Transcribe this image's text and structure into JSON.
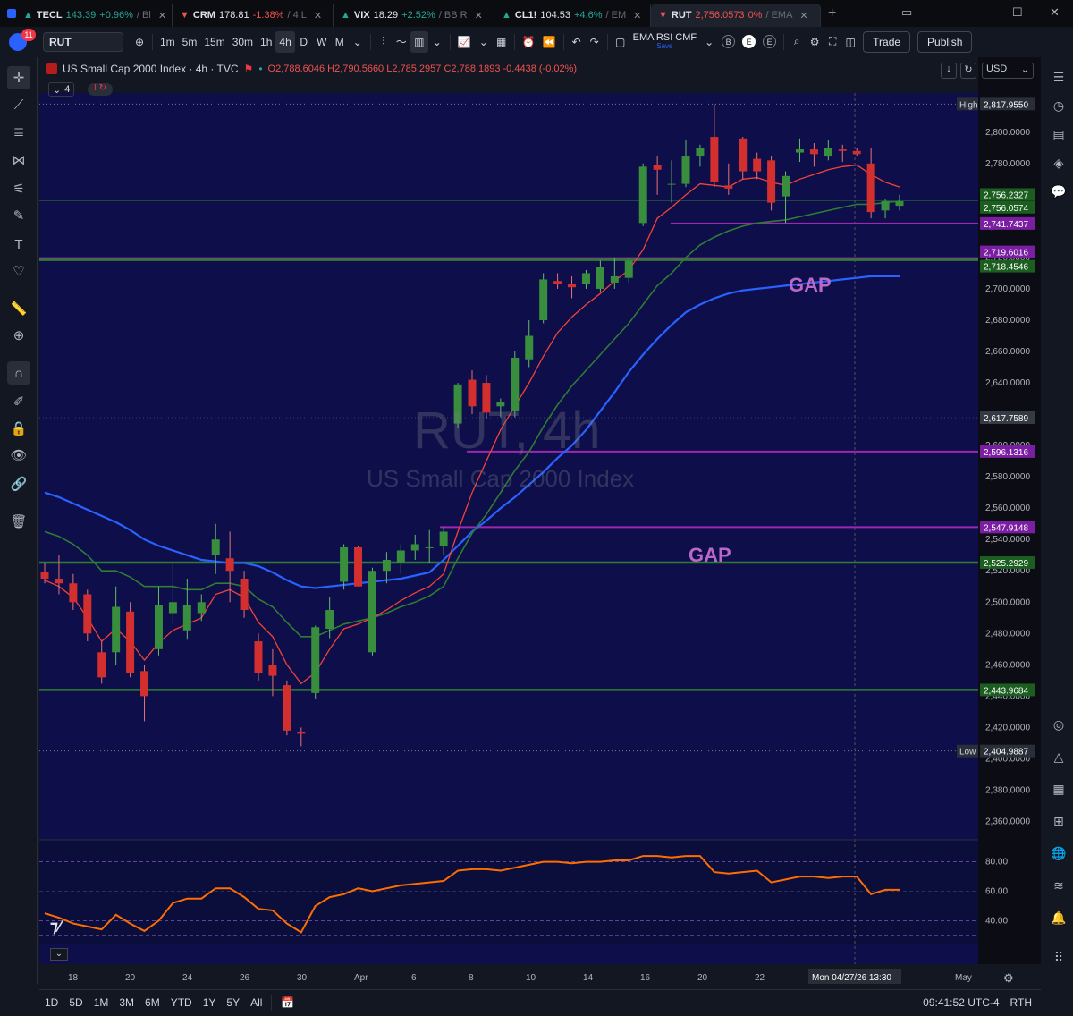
{
  "browser_tabs": [
    {
      "symbol": "TECL",
      "direction": "up",
      "price": "143.39",
      "change": "+0.96%",
      "extra": "/ Bl"
    },
    {
      "symbol": "CRM",
      "direction": "down",
      "price": "178.81",
      "change": "-1.38%",
      "extra": "/ 4 L"
    },
    {
      "symbol": "VIX",
      "direction": "up",
      "price": "18.29",
      "change": "+2.52%",
      "extra": "/ BB R"
    },
    {
      "symbol": "CL1!",
      "direction": "up",
      "price": "104.53",
      "change": "+4.6%",
      "extra": "/ EM"
    },
    {
      "symbol": "RUT",
      "direction": "down",
      "price": "2,756.0573",
      "change": "0%",
      "extra": "/ EMA",
      "active": true
    }
  ],
  "toolbar": {
    "symbol": "RUT",
    "notification_count": "11",
    "intervals": [
      "1m",
      "5m",
      "15m",
      "30m",
      "1h",
      "4h",
      "D",
      "W",
      "M"
    ],
    "selected_interval": "4h",
    "indicator_template": "EMA RSI CMF",
    "template_state": "Save",
    "markers": [
      "B",
      "E",
      "E"
    ],
    "trade_label": "Trade",
    "publish_label": "Publish"
  },
  "legend": {
    "title": "US Small Cap 2000 Index · 4h · TVC",
    "ohlc": "O2,788.6046 H2,790.5660 L2,785.2957 C2,788.1893 -0.4438 (-0.02%)",
    "indicator_count": "4",
    "currency": "USD"
  },
  "watermark": {
    "symbol": "RUT, 4h",
    "name": "US Small Cap 2000 Index"
  },
  "gap_labels": [
    "GAP",
    "GAP"
  ],
  "price_axis": {
    "ticks": [
      "2,800.0000",
      "2,780.0000",
      "2,760.0000",
      "2,740.0000",
      "2,720.0000",
      "2,700.0000",
      "2,680.0000",
      "2,660.0000",
      "2,640.0000",
      "2,620.0000",
      "2,600.0000",
      "2,580.0000",
      "2,560.0000",
      "2,540.0000",
      "2,520.0000",
      "2,500.0000",
      "2,480.0000",
      "2,460.0000",
      "2,440.0000",
      "2,420.0000",
      "2,400.0000",
      "2,380.0000",
      "2,360.0000"
    ],
    "tags": [
      {
        "label": "High",
        "value": "2,817.9550",
        "kind": "extreme"
      },
      {
        "value": "2,756.2327",
        "kind": "green"
      },
      {
        "value": "2,756.0574",
        "kind": "green"
      },
      {
        "value": "2,741.7437",
        "kind": "purple"
      },
      {
        "value": "2,719.6016",
        "kind": "purple"
      },
      {
        "value": "2,718.4546",
        "kind": "green"
      },
      {
        "value": "2,617.7589",
        "kind": "dark"
      },
      {
        "value": "2,596.1316",
        "kind": "purple"
      },
      {
        "value": "2,547.9148",
        "kind": "purple"
      },
      {
        "value": "2,525.2929",
        "kind": "green"
      },
      {
        "value": "2,443.9684",
        "kind": "green"
      },
      {
        "label": "Low",
        "value": "2,404.9887",
        "kind": "extreme"
      }
    ]
  },
  "rsi_axis": [
    "80.00",
    "60.00",
    "40.00"
  ],
  "time_axis": [
    "18",
    "20",
    "24",
    "26",
    "30",
    "Apr",
    "6",
    "8",
    "10",
    "14",
    "16",
    "20",
    "22",
    "May"
  ],
  "crosshair_time": "Mon 04/27/26   13:30",
  "bottom_bar": {
    "ranges": [
      "1D",
      "5D",
      "1M",
      "3M",
      "6M",
      "YTD",
      "1Y",
      "5Y",
      "All"
    ],
    "clock": "09:41:52 UTC-4",
    "session": "RTH"
  },
  "colors": {
    "background": "#131722",
    "up_candle": "#388e3c",
    "down_candle": "#d32f2f",
    "ema_fast": "#f44336",
    "ema_mid": "#2e7d32",
    "ema_slow": "#2962ff",
    "level_purple": "#9c27b0",
    "level_green": "#2e7d32",
    "rsi_line": "#ff6d00"
  },
  "chart_data": {
    "type": "candlestick",
    "interval": "4h",
    "candles": [
      {
        "o": 2519,
        "h": 2525,
        "l": 2512,
        "c": 2515
      },
      {
        "o": 2515,
        "h": 2530,
        "l": 2505,
        "c": 2512
      },
      {
        "o": 2512,
        "h": 2518,
        "l": 2495,
        "c": 2500
      },
      {
        "o": 2505,
        "h": 2508,
        "l": 2475,
        "c": 2480
      },
      {
        "o": 2468,
        "h": 2475,
        "l": 2448,
        "c": 2452
      },
      {
        "o": 2468,
        "h": 2510,
        "l": 2460,
        "c": 2497
      },
      {
        "o": 2494,
        "h": 2500,
        "l": 2452,
        "c": 2455
      },
      {
        "o": 2456,
        "h": 2460,
        "l": 2424,
        "c": 2440
      },
      {
        "o": 2470,
        "h": 2510,
        "l": 2466,
        "c": 2498
      },
      {
        "o": 2493,
        "h": 2525,
        "l": 2486,
        "c": 2500
      },
      {
        "o": 2482,
        "h": 2515,
        "l": 2476,
        "c": 2498
      },
      {
        "o": 2493,
        "h": 2505,
        "l": 2488,
        "c": 2500
      },
      {
        "o": 2530,
        "h": 2550,
        "l": 2518,
        "c": 2540
      },
      {
        "o": 2528,
        "h": 2545,
        "l": 2500,
        "c": 2520
      },
      {
        "o": 2515,
        "h": 2520,
        "l": 2490,
        "c": 2495
      },
      {
        "o": 2475,
        "h": 2480,
        "l": 2450,
        "c": 2455
      },
      {
        "o": 2460,
        "h": 2470,
        "l": 2440,
        "c": 2453
      },
      {
        "o": 2447,
        "h": 2450,
        "l": 2415,
        "c": 2418
      },
      {
        "o": 2417,
        "h": 2420,
        "l": 2408,
        "c": 2416
      },
      {
        "o": 2442,
        "h": 2485,
        "l": 2438,
        "c": 2484
      },
      {
        "o": 2483,
        "h": 2503,
        "l": 2477,
        "c": 2495
      },
      {
        "o": 2513,
        "h": 2537,
        "l": 2508,
        "c": 2535
      },
      {
        "o": 2535,
        "h": 2536,
        "l": 2510,
        "c": 2510
      },
      {
        "o": 2468,
        "h": 2522,
        "l": 2466,
        "c": 2520
      },
      {
        "o": 2520,
        "h": 2532,
        "l": 2512,
        "c": 2527
      },
      {
        "o": 2525,
        "h": 2537,
        "l": 2518,
        "c": 2533
      },
      {
        "o": 2533,
        "h": 2543,
        "l": 2527,
        "c": 2537
      },
      {
        "o": 2535,
        "h": 2546,
        "l": 2525,
        "c": 2535
      },
      {
        "o": 2536,
        "h": 2548,
        "l": 2530,
        "c": 2545
      },
      {
        "o": 2614,
        "h": 2640,
        "l": 2611,
        "c": 2639
      },
      {
        "o": 2642,
        "h": 2648,
        "l": 2620,
        "c": 2625
      },
      {
        "o": 2640,
        "h": 2645,
        "l": 2617,
        "c": 2621
      },
      {
        "o": 2625,
        "h": 2630,
        "l": 2618,
        "c": 2628
      },
      {
        "o": 2622,
        "h": 2660,
        "l": 2618,
        "c": 2656
      },
      {
        "o": 2655,
        "h": 2680,
        "l": 2650,
        "c": 2670
      },
      {
        "o": 2680,
        "h": 2710,
        "l": 2678,
        "c": 2706
      },
      {
        "o": 2705,
        "h": 2710,
        "l": 2700,
        "c": 2703
      },
      {
        "o": 2703,
        "h": 2708,
        "l": 2694,
        "c": 2701
      },
      {
        "o": 2703,
        "h": 2712,
        "l": 2700,
        "c": 2710
      },
      {
        "o": 2700,
        "h": 2718,
        "l": 2698,
        "c": 2714
      },
      {
        "o": 2704,
        "h": 2720,
        "l": 2700,
        "c": 2708
      },
      {
        "o": 2707,
        "h": 2720,
        "l": 2704,
        "c": 2718
      },
      {
        "o": 2742,
        "h": 2780,
        "l": 2740,
        "c": 2778
      },
      {
        "o": 2779,
        "h": 2785,
        "l": 2760,
        "c": 2776
      },
      {
        "o": 2767,
        "h": 2782,
        "l": 2755,
        "c": 2767
      },
      {
        "o": 2767,
        "h": 2795,
        "l": 2765,
        "c": 2785
      },
      {
        "o": 2785,
        "h": 2792,
        "l": 2778,
        "c": 2790
      },
      {
        "o": 2797,
        "h": 2818,
        "l": 2765,
        "c": 2768
      },
      {
        "o": 2766,
        "h": 2780,
        "l": 2760,
        "c": 2764
      },
      {
        "o": 2796,
        "h": 2797,
        "l": 2770,
        "c": 2775
      },
      {
        "o": 2783,
        "h": 2787,
        "l": 2770,
        "c": 2775
      },
      {
        "o": 2782,
        "h": 2785,
        "l": 2750,
        "c": 2755
      },
      {
        "o": 2759,
        "h": 2775,
        "l": 2742,
        "c": 2772
      },
      {
        "o": 2787,
        "h": 2796,
        "l": 2781,
        "c": 2789
      },
      {
        "o": 2789,
        "h": 2793,
        "l": 2778,
        "c": 2786
      },
      {
        "o": 2785,
        "h": 2795,
        "l": 2782,
        "c": 2790
      },
      {
        "o": 2789,
        "h": 2792,
        "l": 2781,
        "c": 2788
      },
      {
        "o": 2788,
        "h": 2790,
        "l": 2785,
        "c": 2786
      },
      {
        "o": 2780,
        "h": 2790,
        "l": 2745,
        "c": 2749
      },
      {
        "o": 2750,
        "h": 2757,
        "l": 2745,
        "c": 2756
      },
      {
        "o": 2753,
        "h": 2760,
        "l": 2750,
        "c": 2756
      }
    ],
    "ema_fast": [
      2514,
      2510,
      2503,
      2490,
      2475,
      2483,
      2475,
      2463,
      2474,
      2482,
      2486,
      2490,
      2505,
      2508,
      2503,
      2487,
      2478,
      2460,
      2448,
      2455,
      2470,
      2483,
      2486,
      2490,
      2495,
      2501,
      2506,
      2510,
      2518,
      2545,
      2570,
      2590,
      2610,
      2625,
      2640,
      2657,
      2672,
      2682,
      2690,
      2697,
      2705,
      2712,
      2725,
      2745,
      2752,
      2760,
      2767,
      2766,
      2765,
      2770,
      2771,
      2768,
      2766,
      2770,
      2773,
      2776,
      2778,
      2779,
      2773,
      2768,
      2765
    ],
    "ema_mid": [
      2545,
      2542,
      2537,
      2530,
      2520,
      2520,
      2516,
      2510,
      2510,
      2510,
      2508,
      2508,
      2512,
      2512,
      2510,
      2502,
      2497,
      2487,
      2478,
      2478,
      2482,
      2486,
      2488,
      2490,
      2493,
      2497,
      2500,
      2504,
      2510,
      2528,
      2544,
      2556,
      2570,
      2584,
      2596,
      2612,
      2626,
      2638,
      2648,
      2658,
      2668,
      2678,
      2690,
      2702,
      2710,
      2720,
      2728,
      2733,
      2737,
      2740,
      2742,
      2743,
      2744,
      2746,
      2748,
      2750,
      2752,
      2754,
      2754,
      2755,
      2756
    ],
    "ema_slow": [
      2570,
      2567,
      2563,
      2559,
      2555,
      2551,
      2546,
      2540,
      2536,
      2533,
      2530,
      2527,
      2526,
      2525,
      2525,
      2523,
      2519,
      2514,
      2510,
      2509,
      2510,
      2511,
      2512,
      2513,
      2514,
      2515,
      2517,
      2519,
      2527,
      2536,
      2545,
      2552,
      2560,
      2567,
      2575,
      2583,
      2592,
      2600,
      2610,
      2622,
      2634,
      2647,
      2658,
      2668,
      2677,
      2685,
      2690,
      2694,
      2697,
      2699,
      2700,
      2701,
      2702,
      2703,
      2704,
      2705,
      2706,
      2707,
      2708,
      2708,
      2708
    ],
    "levels": [
      {
        "value": 2741.7437,
        "color": "purple"
      },
      {
        "value": 2719.6016,
        "color": "purple"
      },
      {
        "value": 2718.4546,
        "color": "green"
      },
      {
        "value": 2596.1316,
        "color": "purple"
      },
      {
        "value": 2547.9148,
        "color": "purple"
      },
      {
        "value": 2525.2929,
        "color": "green"
      },
      {
        "value": 2443.9684,
        "color": "green"
      }
    ],
    "rsi": [
      45,
      42,
      38,
      36,
      34,
      44,
      38,
      33,
      40,
      52,
      55,
      55,
      62,
      62,
      56,
      48,
      47,
      38,
      32,
      50,
      56,
      58,
      62,
      60,
      62,
      64,
      65,
      66,
      67,
      74,
      75,
      75,
      74,
      76,
      78,
      80,
      80,
      79,
      80,
      80,
      81,
      81,
      84,
      84,
      83,
      84,
      84,
      73,
      72,
      73,
      74,
      66,
      68,
      70,
      70,
      69,
      70,
      70,
      58,
      61,
      61
    ],
    "ylim": [
      2350,
      2825
    ],
    "rsi_ylim": [
      25,
      95
    ]
  }
}
